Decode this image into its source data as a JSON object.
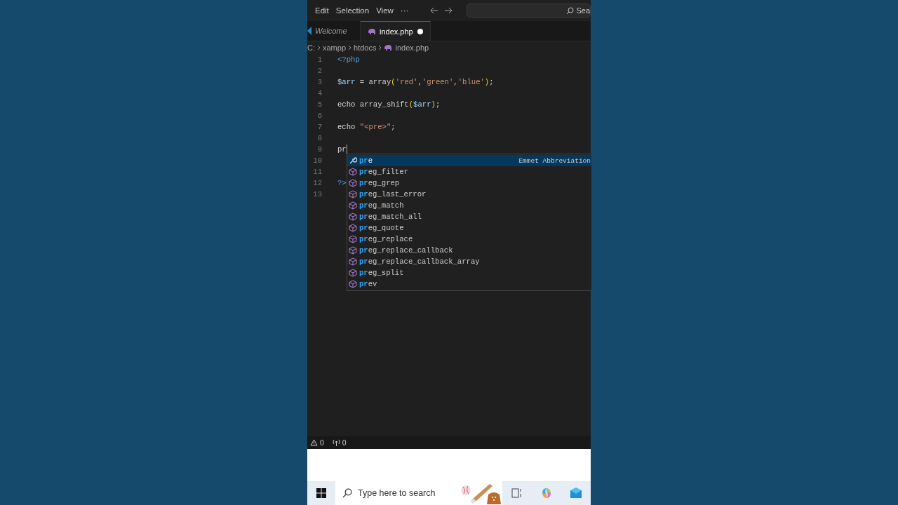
{
  "menu": {
    "items": [
      "Edit",
      "Selection",
      "View",
      "···"
    ],
    "search": {
      "value": "Sea"
    }
  },
  "tabs": [
    {
      "label": "Welcome",
      "kind": "preview",
      "selected": false,
      "modified": false
    },
    {
      "label": "index.php",
      "kind": "php",
      "selected": true,
      "modified": true
    }
  ],
  "breadcrumbs": [
    {
      "label": "C:",
      "kind": "text"
    },
    {
      "label": "xampp",
      "kind": "text"
    },
    {
      "label": "htdocs",
      "kind": "text"
    },
    {
      "label": "index.php",
      "kind": "php"
    }
  ],
  "editor": {
    "lines": [
      {
        "number": "1",
        "tokens": [
          {
            "text": "<?php",
            "kind": "tag"
          }
        ]
      },
      {
        "number": "2"
      },
      {
        "number": "3",
        "tokens": [
          {
            "text": "$arr",
            "kind": "var"
          },
          {
            "text": " = ",
            "kind": "plain"
          },
          {
            "text": "array",
            "kind": "plain"
          },
          {
            "text": "(",
            "kind": "brace"
          },
          {
            "text": "'red'",
            "kind": "str"
          },
          {
            "text": ",",
            "kind": "plain"
          },
          {
            "text": "'green'",
            "kind": "str"
          },
          {
            "text": ",",
            "kind": "plain"
          },
          {
            "text": "'blue'",
            "kind": "str"
          },
          {
            "text": ")",
            "kind": "brace"
          },
          {
            "text": ";",
            "kind": "plain"
          }
        ]
      },
      {
        "number": "4"
      },
      {
        "number": "5",
        "tokens": [
          {
            "text": "echo ",
            "kind": "plain"
          },
          {
            "text": "array_shift",
            "kind": "plain"
          },
          {
            "text": "(",
            "kind": "brace"
          },
          {
            "text": "$arr",
            "kind": "var"
          },
          {
            "text": ")",
            "kind": "brace"
          },
          {
            "text": ";",
            "kind": "plain"
          }
        ]
      },
      {
        "number": "6"
      },
      {
        "number": "7",
        "tokens": [
          {
            "text": "echo ",
            "kind": "plain"
          },
          {
            "text": "\"<pre>\"",
            "kind": "str"
          },
          {
            "text": ";",
            "kind": "plain"
          }
        ]
      },
      {
        "number": "8"
      },
      {
        "number": "9",
        "tokens": [
          {
            "text": "pr",
            "kind": "plain"
          }
        ],
        "cursor": true
      },
      {
        "number": "10"
      },
      {
        "number": "11"
      },
      {
        "number": "12",
        "tokens": [
          {
            "text": "?>",
            "kind": "tag"
          }
        ]
      },
      {
        "number": "13"
      }
    ]
  },
  "suggestions": [
    {
      "match": "pr",
      "rest": "e",
      "kind": "snippet",
      "detail": "Emmet Abbreviation",
      "selected": true
    },
    {
      "match": "pr",
      "rest": "eg_filter",
      "kind": "function",
      "selected": false
    },
    {
      "match": "pr",
      "rest": "eg_grep",
      "kind": "function",
      "selected": false
    },
    {
      "match": "pr",
      "rest": "eg_last_error",
      "kind": "function",
      "selected": false
    },
    {
      "match": "pr",
      "rest": "eg_match",
      "kind": "function",
      "selected": false
    },
    {
      "match": "pr",
      "rest": "eg_match_all",
      "kind": "function",
      "selected": false
    },
    {
      "match": "pr",
      "rest": "eg_quote",
      "kind": "function",
      "selected": false
    },
    {
      "match": "pr",
      "rest": "eg_replace",
      "kind": "function",
      "selected": false
    },
    {
      "match": "pr",
      "rest": "eg_replace_callback",
      "kind": "function",
      "selected": false
    },
    {
      "match": "pr",
      "rest": "eg_replace_callback_array",
      "kind": "function",
      "selected": false
    },
    {
      "match": "pr",
      "rest": "eg_split",
      "kind": "function",
      "selected": false
    },
    {
      "match": "pr",
      "rest": "ev",
      "kind": "function",
      "selected": false
    }
  ],
  "status_bar": {
    "warnings": "0",
    "ports": "0"
  },
  "taskbar": {
    "search": {
      "placeholder": "Type here to search"
    }
  }
}
